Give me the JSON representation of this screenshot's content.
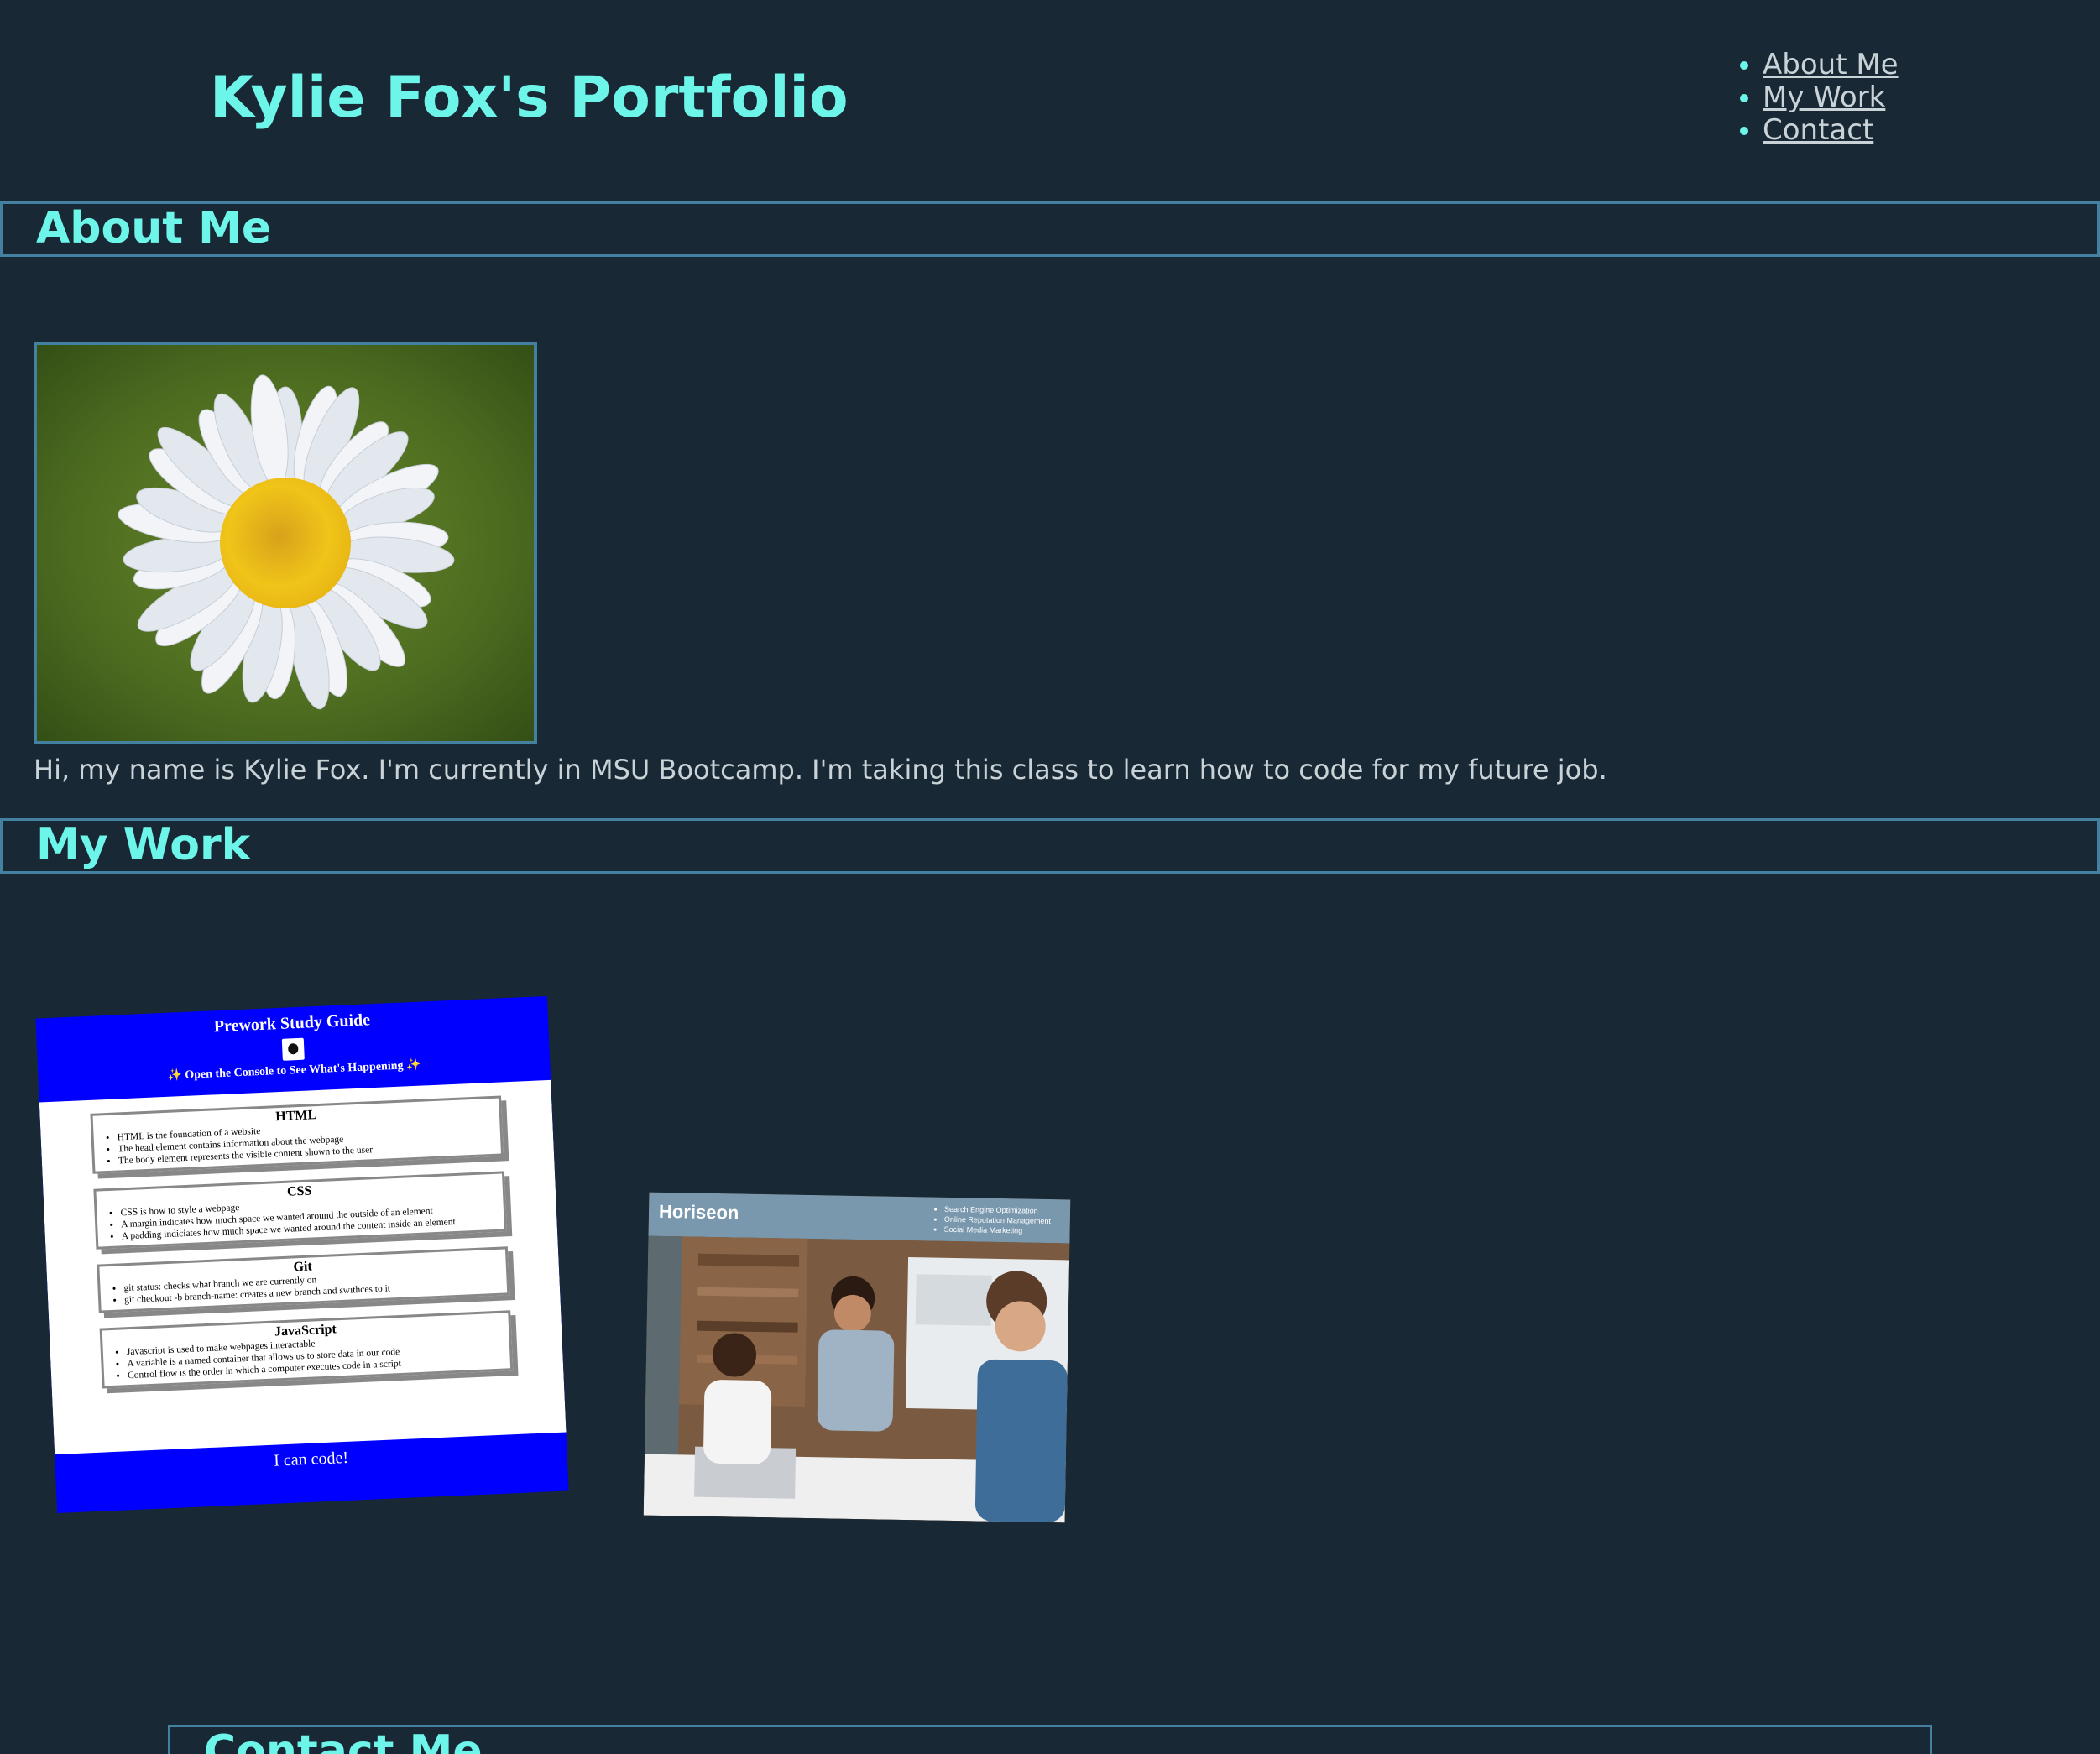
{
  "header": {
    "title": "Kylie Fox's Portfolio",
    "nav": [
      "About Me",
      "My Work",
      "Contact"
    ]
  },
  "about": {
    "heading": "About Me",
    "text": "Hi, my name is Kylie Fox. I'm currently in MSU Bootcamp. I'm taking this class to learn how to code for my future job."
  },
  "work": {
    "heading": "My Work",
    "prework": {
      "title": "Prework Study Guide",
      "tagline": "✨ Open the Console to See What's Happening ✨",
      "sections": [
        {
          "title": "HTML",
          "items": [
            "HTML is the foundation of a website",
            "The head element contains information about the webpage",
            "The body element represents the visible content shown to the user"
          ]
        },
        {
          "title": "CSS",
          "items": [
            "CSS is how to style a webpage",
            "A margin indicates how much space we wanted around the outside of an element",
            "A padding indiciates how much space we wanted around the content inside an element"
          ]
        },
        {
          "title": "Git",
          "items": [
            "git status: checks what branch we are currently on",
            "git checkout -b branch-name: creates a new branch and swithces to it"
          ]
        },
        {
          "title": "JavaScript",
          "items": [
            "Javascript is used to make webpages interactable",
            "A variable is a named container that allows us to store data in our code",
            "Control flow is the order in which a computer executes code in a script"
          ]
        }
      ],
      "footer": "I can code!"
    },
    "horiseon": {
      "logo": "Horiseon",
      "services": [
        "Search Engine Optimization",
        "Online Reputation Management",
        "Social Media Marketing"
      ]
    }
  },
  "contact": {
    "heading": "Contact Me"
  },
  "colors": {
    "background": "#182835",
    "accent": "#6ef5ea",
    "border": "#44809f",
    "text": "#c9d2d6"
  }
}
